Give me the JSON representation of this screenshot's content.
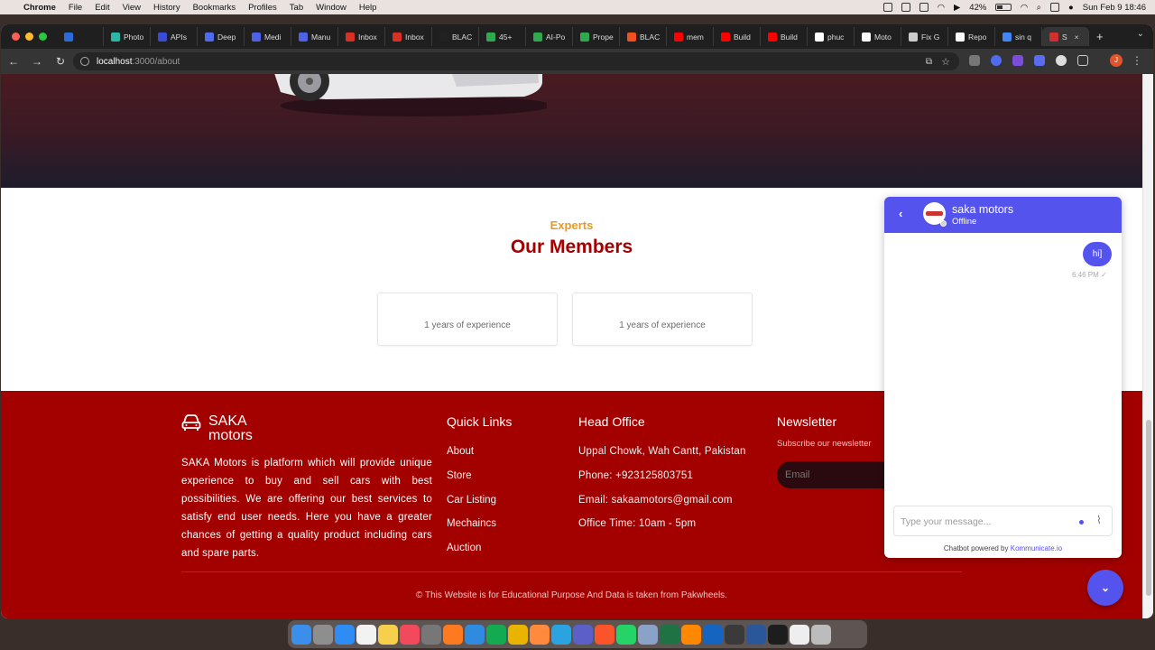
{
  "macos_menubar": {
    "app_name": "Chrome",
    "menus": [
      "File",
      "Edit",
      "View",
      "History",
      "Bookmarks",
      "Profiles",
      "Tab",
      "Window",
      "Help"
    ],
    "battery": "42%",
    "clock": "Sun Feb 9  18:46"
  },
  "browser": {
    "tabs": [
      {
        "label": "",
        "color": "#2b6cd8",
        "icon": "outlook-icon"
      },
      {
        "label": "Photo",
        "color": "#2bb7a6",
        "icon": "photo-icon"
      },
      {
        "label": "APIs",
        "color": "#3a4bd6",
        "icon": "api-icon"
      },
      {
        "label": "Deep",
        "color": "#4f6cf0",
        "icon": "deepseek-icon"
      },
      {
        "label": "Medi",
        "color": "#4e62e8",
        "icon": "media-icon"
      },
      {
        "label": "Manu",
        "color": "#4e62e8",
        "icon": "manual-icon"
      },
      {
        "label": "Inbox",
        "color": "#d93025",
        "icon": "gmail-icon"
      },
      {
        "label": "Inbox",
        "color": "#d93025",
        "icon": "gmail-icon"
      },
      {
        "label": "BLAC",
        "color": "#222222",
        "icon": "blackbox-icon"
      },
      {
        "label": "45+",
        "color": "#2fa84f",
        "icon": "link-icon"
      },
      {
        "label": "AI-Po",
        "color": "#2fa84f",
        "icon": "link-icon"
      },
      {
        "label": "Prope",
        "color": "#2fa84f",
        "icon": "link-icon"
      },
      {
        "label": "BLAC",
        "color": "#f25022",
        "icon": "microsoft-icon"
      },
      {
        "label": "mem",
        "color": "#ff0000",
        "icon": "youtube-icon"
      },
      {
        "label": "Build",
        "color": "#ff0000",
        "icon": "youtube-icon"
      },
      {
        "label": "Build",
        "color": "#ff0000",
        "icon": "youtube-icon"
      },
      {
        "label": "phuc",
        "color": "#ffffff",
        "icon": "github-icon"
      },
      {
        "label": "Moto",
        "color": "#ffffff",
        "icon": "github-icon"
      },
      {
        "label": "Fix G",
        "color": "#cccccc",
        "icon": "web-icon"
      },
      {
        "label": "Repo",
        "color": "#ffffff",
        "icon": "github-icon"
      },
      {
        "label": "sin q",
        "color": "#4285f4",
        "icon": "google-icon"
      },
      {
        "label": "S",
        "color": "#d32f2f",
        "icon": "saka-icon",
        "active": true
      }
    ],
    "new_tab_label": "+",
    "url_host": "localhost",
    "url_path": ":3000/about"
  },
  "hero": {
    "car_colors": {
      "body": "#e9e9ec",
      "wheel": "#2a2a2a"
    }
  },
  "members": {
    "eyebrow": "Experts",
    "title": "Our Members",
    "cards": [
      {
        "experience": "1 years of experience"
      },
      {
        "experience": "1 years of experience"
      }
    ]
  },
  "footer": {
    "brand_line1": "SAKA",
    "brand_line2": "motors",
    "about": "SAKA Motors is platform which will provide unique experience to buy and sell cars with best possibilities. We are offering our best services to satisfy end user needs. Here you have a greater chances of getting a quality product including cars and spare parts.",
    "quick_links_title": "Quick Links",
    "quick_links": [
      "About",
      "Store",
      "Car Listing",
      "Mechaincs",
      "Auction"
    ],
    "head_office_title": "Head Office",
    "head_office": [
      "Uppal Chowk, Wah Cantt, Pakistan",
      "Phone: +923125803751",
      "Email: sakaamotors@gmail.com",
      "Office Time: 10am - 5pm"
    ],
    "newsletter_title": "Newsletter",
    "newsletter_subtitle": "Subscribe our newsletter",
    "email_placeholder": "Email",
    "copyright": "© This Website is for Educational Purpose And Data is taken from Pakwheels."
  },
  "chat": {
    "name": "saka motors",
    "status": "Offline",
    "messages": [
      {
        "text": "hi]",
        "time": "6:46 PM ✓"
      }
    ],
    "composer_placeholder": "Type your message...",
    "powered_prefix": "Chatbot powered by ",
    "powered_brand": "Kommunicate.io"
  },
  "colors": {
    "brand_red": "#a30000",
    "accent_orange": "#e79b20",
    "chat_accent": "#5553ee"
  },
  "dock": {
    "apps": [
      {
        "name": "finder",
        "color": "#3b8eea"
      },
      {
        "name": "launchpad",
        "color": "#8e8e8e"
      },
      {
        "name": "safari",
        "color": "#2f8cf4"
      },
      {
        "name": "reminders",
        "color": "#f2f2f2"
      },
      {
        "name": "notes",
        "color": "#f6d04d"
      },
      {
        "name": "music",
        "color": "#f2495c"
      },
      {
        "name": "settings",
        "color": "#777777"
      },
      {
        "name": "firefox",
        "color": "#ff7a1f"
      },
      {
        "name": "vscode",
        "color": "#2f8be0"
      },
      {
        "name": "mongodb",
        "color": "#13aa52"
      },
      {
        "name": "chrome",
        "color": "#e8b400"
      },
      {
        "name": "sublime",
        "color": "#ff8a3d"
      },
      {
        "name": "telegram",
        "color": "#2aa3e0"
      },
      {
        "name": "teams",
        "color": "#5b5fc7"
      },
      {
        "name": "brave",
        "color": "#fb542b"
      },
      {
        "name": "whatsapp",
        "color": "#25d366"
      },
      {
        "name": "preview",
        "color": "#8aa2c8"
      },
      {
        "name": "excel",
        "color": "#1f7244"
      },
      {
        "name": "vlc",
        "color": "#ff8800"
      },
      {
        "name": "outlook",
        "color": "#1565c0"
      },
      {
        "name": "quicktime",
        "color": "#3a3a3a"
      },
      {
        "name": "word",
        "color": "#2b579a"
      },
      {
        "name": "terminal",
        "color": "#1d1d1d"
      },
      {
        "name": "carapp",
        "color": "#eeeeee"
      },
      {
        "name": "trash",
        "color": "#bcbcbc"
      }
    ]
  }
}
